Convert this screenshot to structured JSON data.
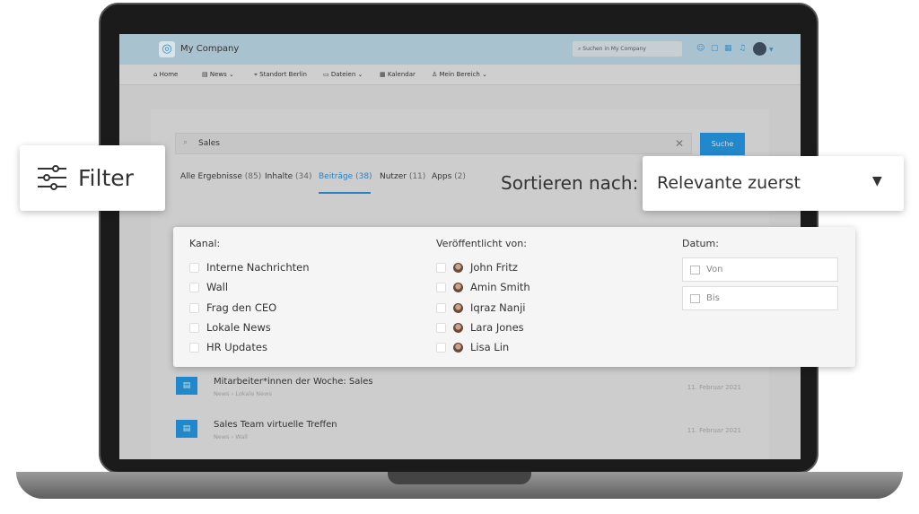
{
  "app": {
    "company": "My Company",
    "search_placeholder": "Suchen in My Company"
  },
  "nav": [
    "Home",
    "News",
    "Standort Berlin",
    "Dateien",
    "Kalendar",
    "Mein Bereich"
  ],
  "search": {
    "value": "Sales",
    "button": "Suche"
  },
  "tabs": [
    {
      "label": "Alle Ergebnisse",
      "count": "(85)"
    },
    {
      "label": "Inhalte",
      "count": "(34)"
    },
    {
      "label": "Beiträge",
      "count": "(38)"
    },
    {
      "label": "Nutzer",
      "count": "(11)"
    },
    {
      "label": "Apps",
      "count": "(2)"
    }
  ],
  "filter": {
    "label": "Filter"
  },
  "sort": {
    "label": "Sortieren nach:",
    "value": "Relevante zuerst"
  },
  "panel": {
    "kanal": {
      "title": "Kanal:",
      "options": [
        "Interne Nachrichten",
        "Wall",
        "Frag den CEO",
        "Lokale News",
        "HR Updates"
      ]
    },
    "von": {
      "title": "Veröffentlicht von:",
      "options": [
        "John Fritz",
        "Amin Smith",
        "Iqraz Nanji",
        "Lara Jones",
        "Lisa Lin"
      ]
    },
    "datum": {
      "title": "Datum:",
      "from": "Von",
      "to": "Bis"
    }
  },
  "results": [
    {
      "title": "Mitarbeiter*innen der Woche: Sales",
      "path": [
        "News",
        "Lokale News"
      ],
      "date": "11. Februar 2021"
    },
    {
      "title": "Sales Team virtuelle Treffen",
      "path": [
        "News",
        "Wall"
      ],
      "date": "11. Februar 2021"
    }
  ],
  "colors": {
    "accent": "#2288cc",
    "header": "#a9c2cf"
  }
}
